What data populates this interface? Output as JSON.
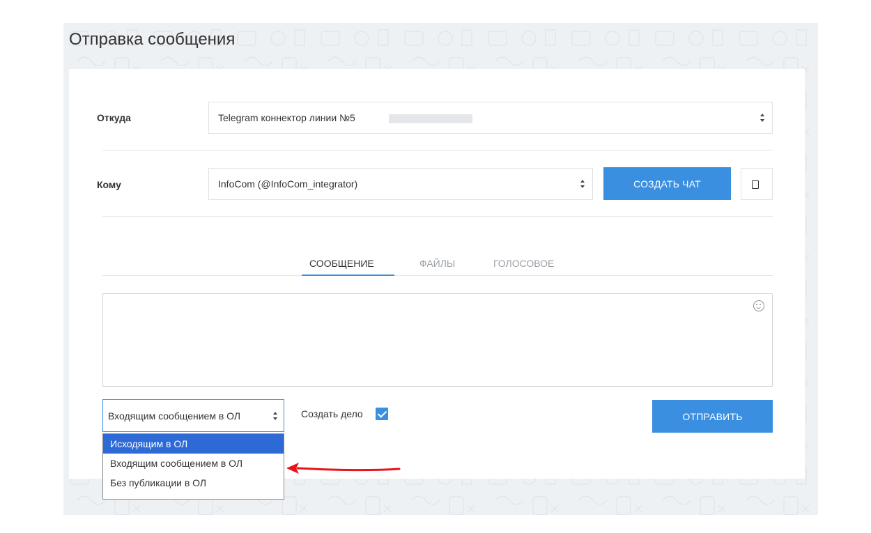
{
  "page": {
    "title": "Отправка сообщения"
  },
  "form": {
    "from": {
      "label": "Откуда",
      "value": "Telegram коннектор линии №5"
    },
    "to": {
      "label": "Кому",
      "value": "InfoCom (@InfoCom_integrator)"
    },
    "create_chat_label": "СОЗДАТЬ ЧАТ",
    "copy_icon": "copy-icon"
  },
  "tabs": [
    {
      "label": "СООБЩЕНИЕ",
      "active": true
    },
    {
      "label": "ФАЙЛЫ",
      "active": false
    },
    {
      "label": "ГОЛОСОВОЕ",
      "active": false
    }
  ],
  "message": {
    "value": "",
    "emoji_icon": "smiley-icon"
  },
  "publication": {
    "selected": "Входящим сообщением в ОЛ",
    "options": [
      "Исходящим в ОЛ",
      "Входящим сообщением в ОЛ",
      "Без публикации в ОЛ"
    ],
    "highlighted_index": 0
  },
  "task": {
    "label": "Создать дело",
    "checked": true
  },
  "send_label": "ОТПРАВИТЬ",
  "colors": {
    "accent": "#3b8fe0",
    "highlight": "#2d6ad6",
    "annotation": "#e8131a"
  }
}
